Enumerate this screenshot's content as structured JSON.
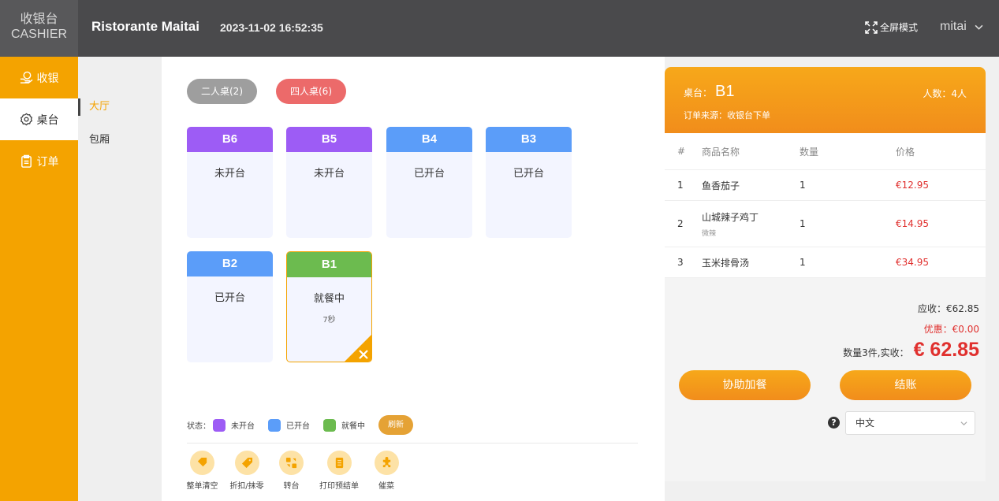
{
  "header": {
    "logo_cn": "收银台",
    "logo_en": "CASHIER",
    "restaurant": "Ristorante Maitai",
    "datetime": "2023-11-02 16:52:35",
    "fullscreen": "全屏模式",
    "user": "mitai"
  },
  "nav": {
    "items": [
      {
        "label": "收银",
        "icon": "cash-register-icon"
      },
      {
        "label": "桌台",
        "icon": "gear-icon"
      },
      {
        "label": "订单",
        "icon": "clipboard-icon"
      }
    ]
  },
  "subnav": {
    "items": [
      {
        "label": "大厅"
      },
      {
        "label": "包厢"
      }
    ]
  },
  "table_types": [
    {
      "label": "二人桌(2)",
      "color": "#9e9e9e"
    },
    {
      "label": "四人桌(6)",
      "color": "#ec6a6a"
    }
  ],
  "tables": [
    {
      "name": "B6",
      "status": "未开台",
      "color": "#9d5cf5"
    },
    {
      "name": "B5",
      "status": "未开台",
      "color": "#9d5cf5"
    },
    {
      "name": "B4",
      "status": "已开台",
      "color": "#5b9df9"
    },
    {
      "name": "B3",
      "status": "已开台",
      "color": "#5b9df9"
    },
    {
      "name": "B2",
      "status": "已开台",
      "color": "#5b9df9"
    },
    {
      "name": "B1",
      "status": "就餐中",
      "timer": "7秒",
      "color": "#6cbb4f"
    }
  ],
  "legend": {
    "label": "状态：",
    "items": [
      {
        "label": "未开台",
        "color": "#9d5cf5"
      },
      {
        "label": "已开台",
        "color": "#5b9df9"
      },
      {
        "label": "就餐中",
        "color": "#6cbb4f"
      }
    ],
    "refresh": "刷新"
  },
  "actions": [
    {
      "label": "整单清空",
      "icon": "clear-tag-icon"
    },
    {
      "label": "折扣/抹零",
      "icon": "discount-tag-icon"
    },
    {
      "label": "转台",
      "icon": "transfer-icon"
    },
    {
      "label": "打印预结单",
      "icon": "print-receipt-icon"
    },
    {
      "label": "催菜",
      "icon": "puzzle-icon"
    }
  ],
  "order": {
    "table_label": "桌台：",
    "table": "B1",
    "people": "人数：4人",
    "source": "订单来源：收银台下单",
    "columns": [
      "#",
      "商品名称",
      "数量",
      "价格"
    ],
    "rows": [
      {
        "no": "1",
        "name": "鱼香茄子",
        "note": "",
        "qty": "1",
        "price": "€12.95"
      },
      {
        "no": "2",
        "name": "山城辣子鸡丁",
        "note": "微辣",
        "qty": "1",
        "price": "€14.95"
      },
      {
        "no": "3",
        "name": "玉米排骨汤",
        "note": "",
        "qty": "1",
        "price": "€34.95"
      }
    ],
    "due": "应收：€62.85",
    "discount": "优惠：€0.00",
    "paid_label": "数量3件,实收：",
    "paid": "€ 62.85",
    "assist_btn": "协助加餐",
    "checkout_btn": "结账",
    "language": "中文"
  }
}
